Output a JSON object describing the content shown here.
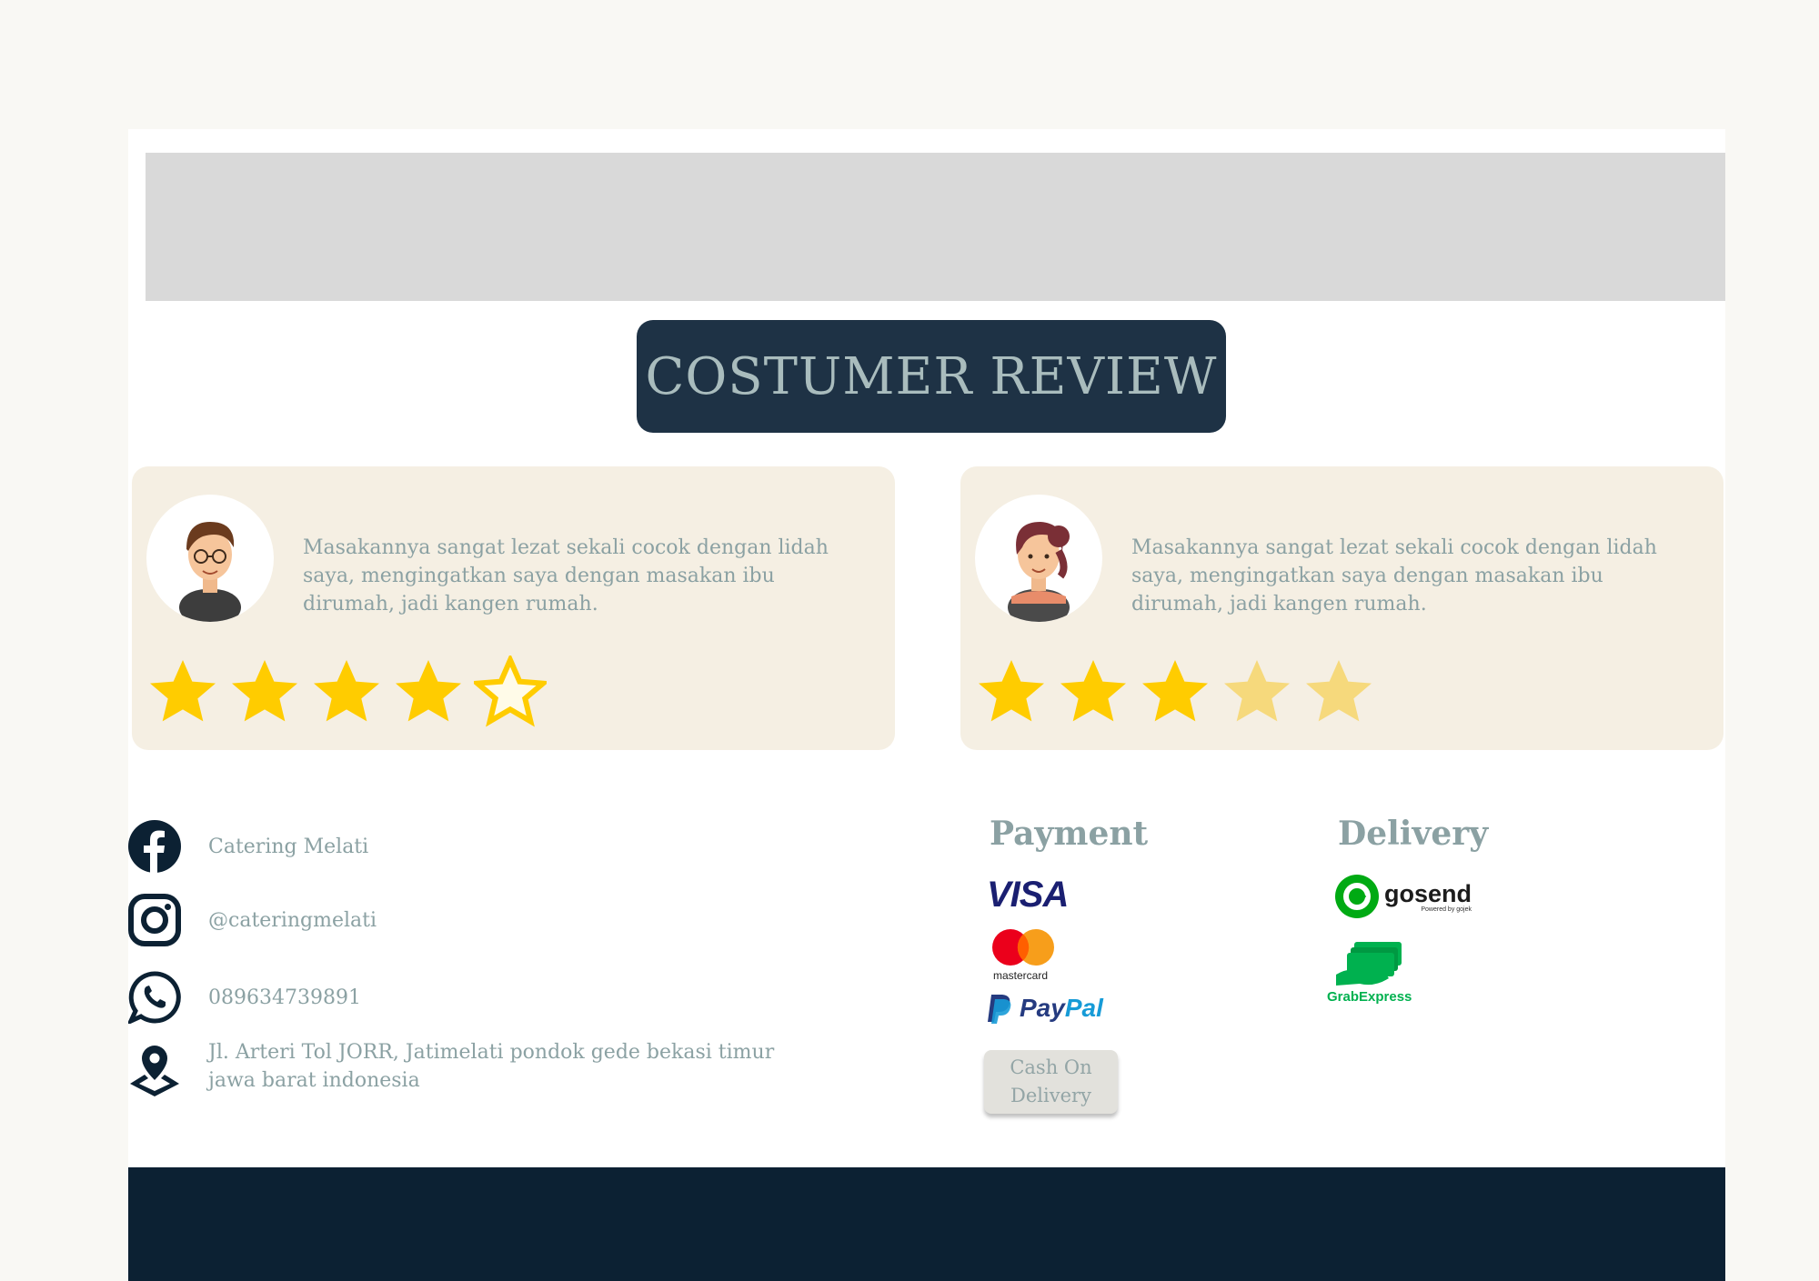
{
  "section_title": "COSTUMER REVIEW",
  "reviews": [
    {
      "text": "Masakannya sangat lezat sekali  cocok dengan lidah saya, mengingatkan saya dengan masakan ibu dirumah, jadi kangen rumah.",
      "rating": 4
    },
    {
      "text": "Masakannya sangat lezat sekali  cocok dengan lidah saya, mengingatkan saya dengan masakan ibu dirumah, jadi kangen rumah.",
      "rating": 3
    }
  ],
  "contact": {
    "facebook": "Catering Melati",
    "instagram": "@cateringmelati",
    "whatsapp": "089634739891",
    "address_line1": "Jl. Arteri Tol JORR, Jatimelati pondok gede bekasi timur",
    "address_line2": "jawa barat indonesia"
  },
  "payment": {
    "heading": "Payment",
    "visa": "VISA",
    "mastercard": "mastercard",
    "paypal_p1": "Pay",
    "paypal_p2": "Pal",
    "cod_line1": "Cash On",
    "cod_line2": "Delivery"
  },
  "delivery": {
    "heading": "Delivery",
    "gosend": "gosend",
    "gosend_sub": "Powered by gojek",
    "grab": "GrabExpress"
  },
  "colors": {
    "star_filled": "#ffcc00",
    "star_faded": "#f6d97c",
    "title_bg": "#1e3245",
    "footer_bg": "#0c2133"
  }
}
